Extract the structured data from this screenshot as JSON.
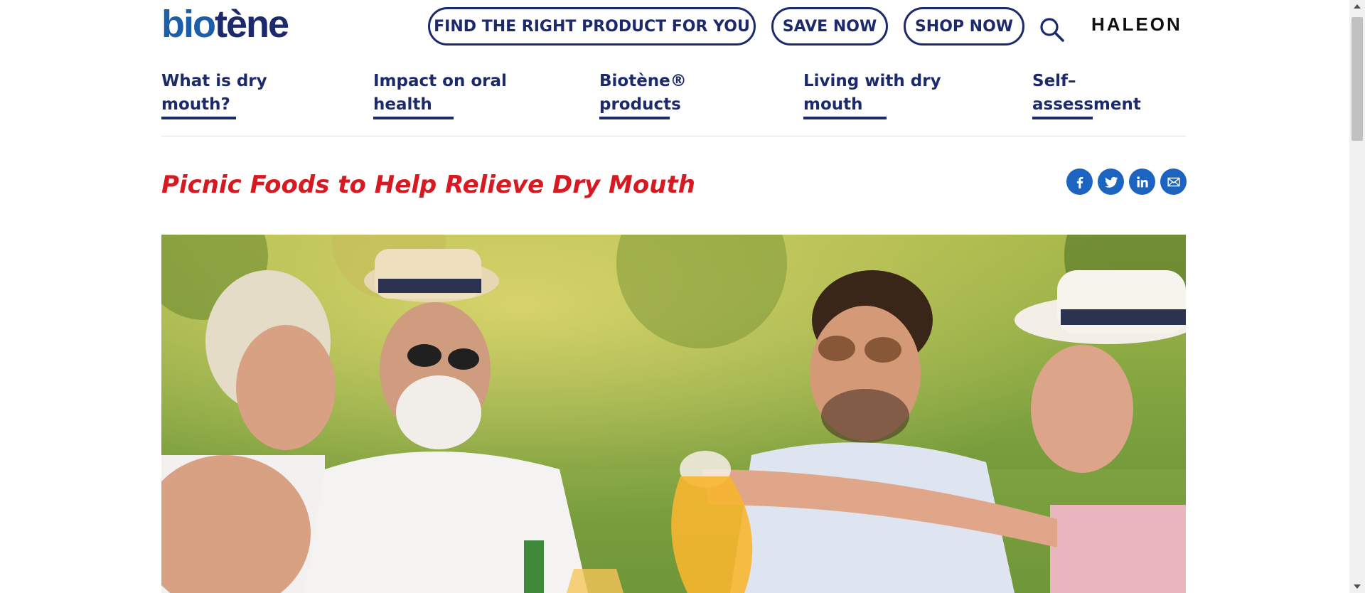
{
  "header": {
    "logo": {
      "part1": "bio",
      "part2": "tène"
    },
    "buttons": {
      "find": "FIND THE RIGHT PRODUCT FOR YOU",
      "save": "SAVE NOW",
      "shop": "SHOP NOW"
    },
    "search_icon": "search-icon",
    "partner_logo": "HALEON"
  },
  "nav": {
    "items": [
      {
        "label": "What is dry mouth?"
      },
      {
        "label": "Impact on oral health"
      },
      {
        "label": "Biotène® products"
      },
      {
        "label": "Living with dry mouth"
      },
      {
        "label": "Self–assessment"
      }
    ]
  },
  "article": {
    "title": "Picnic Foods to Help Relieve Dry Mouth",
    "share": [
      {
        "icon": "facebook-icon"
      },
      {
        "icon": "twitter-icon"
      },
      {
        "icon": "linkedin-icon"
      },
      {
        "icon": "email-icon"
      }
    ],
    "hero_image": "photo of four people laughing at an outdoor picnic"
  },
  "colors": {
    "brand_navy": "#1c2a6b",
    "title_red": "#d71921",
    "social_blue": "#1c64c0"
  }
}
